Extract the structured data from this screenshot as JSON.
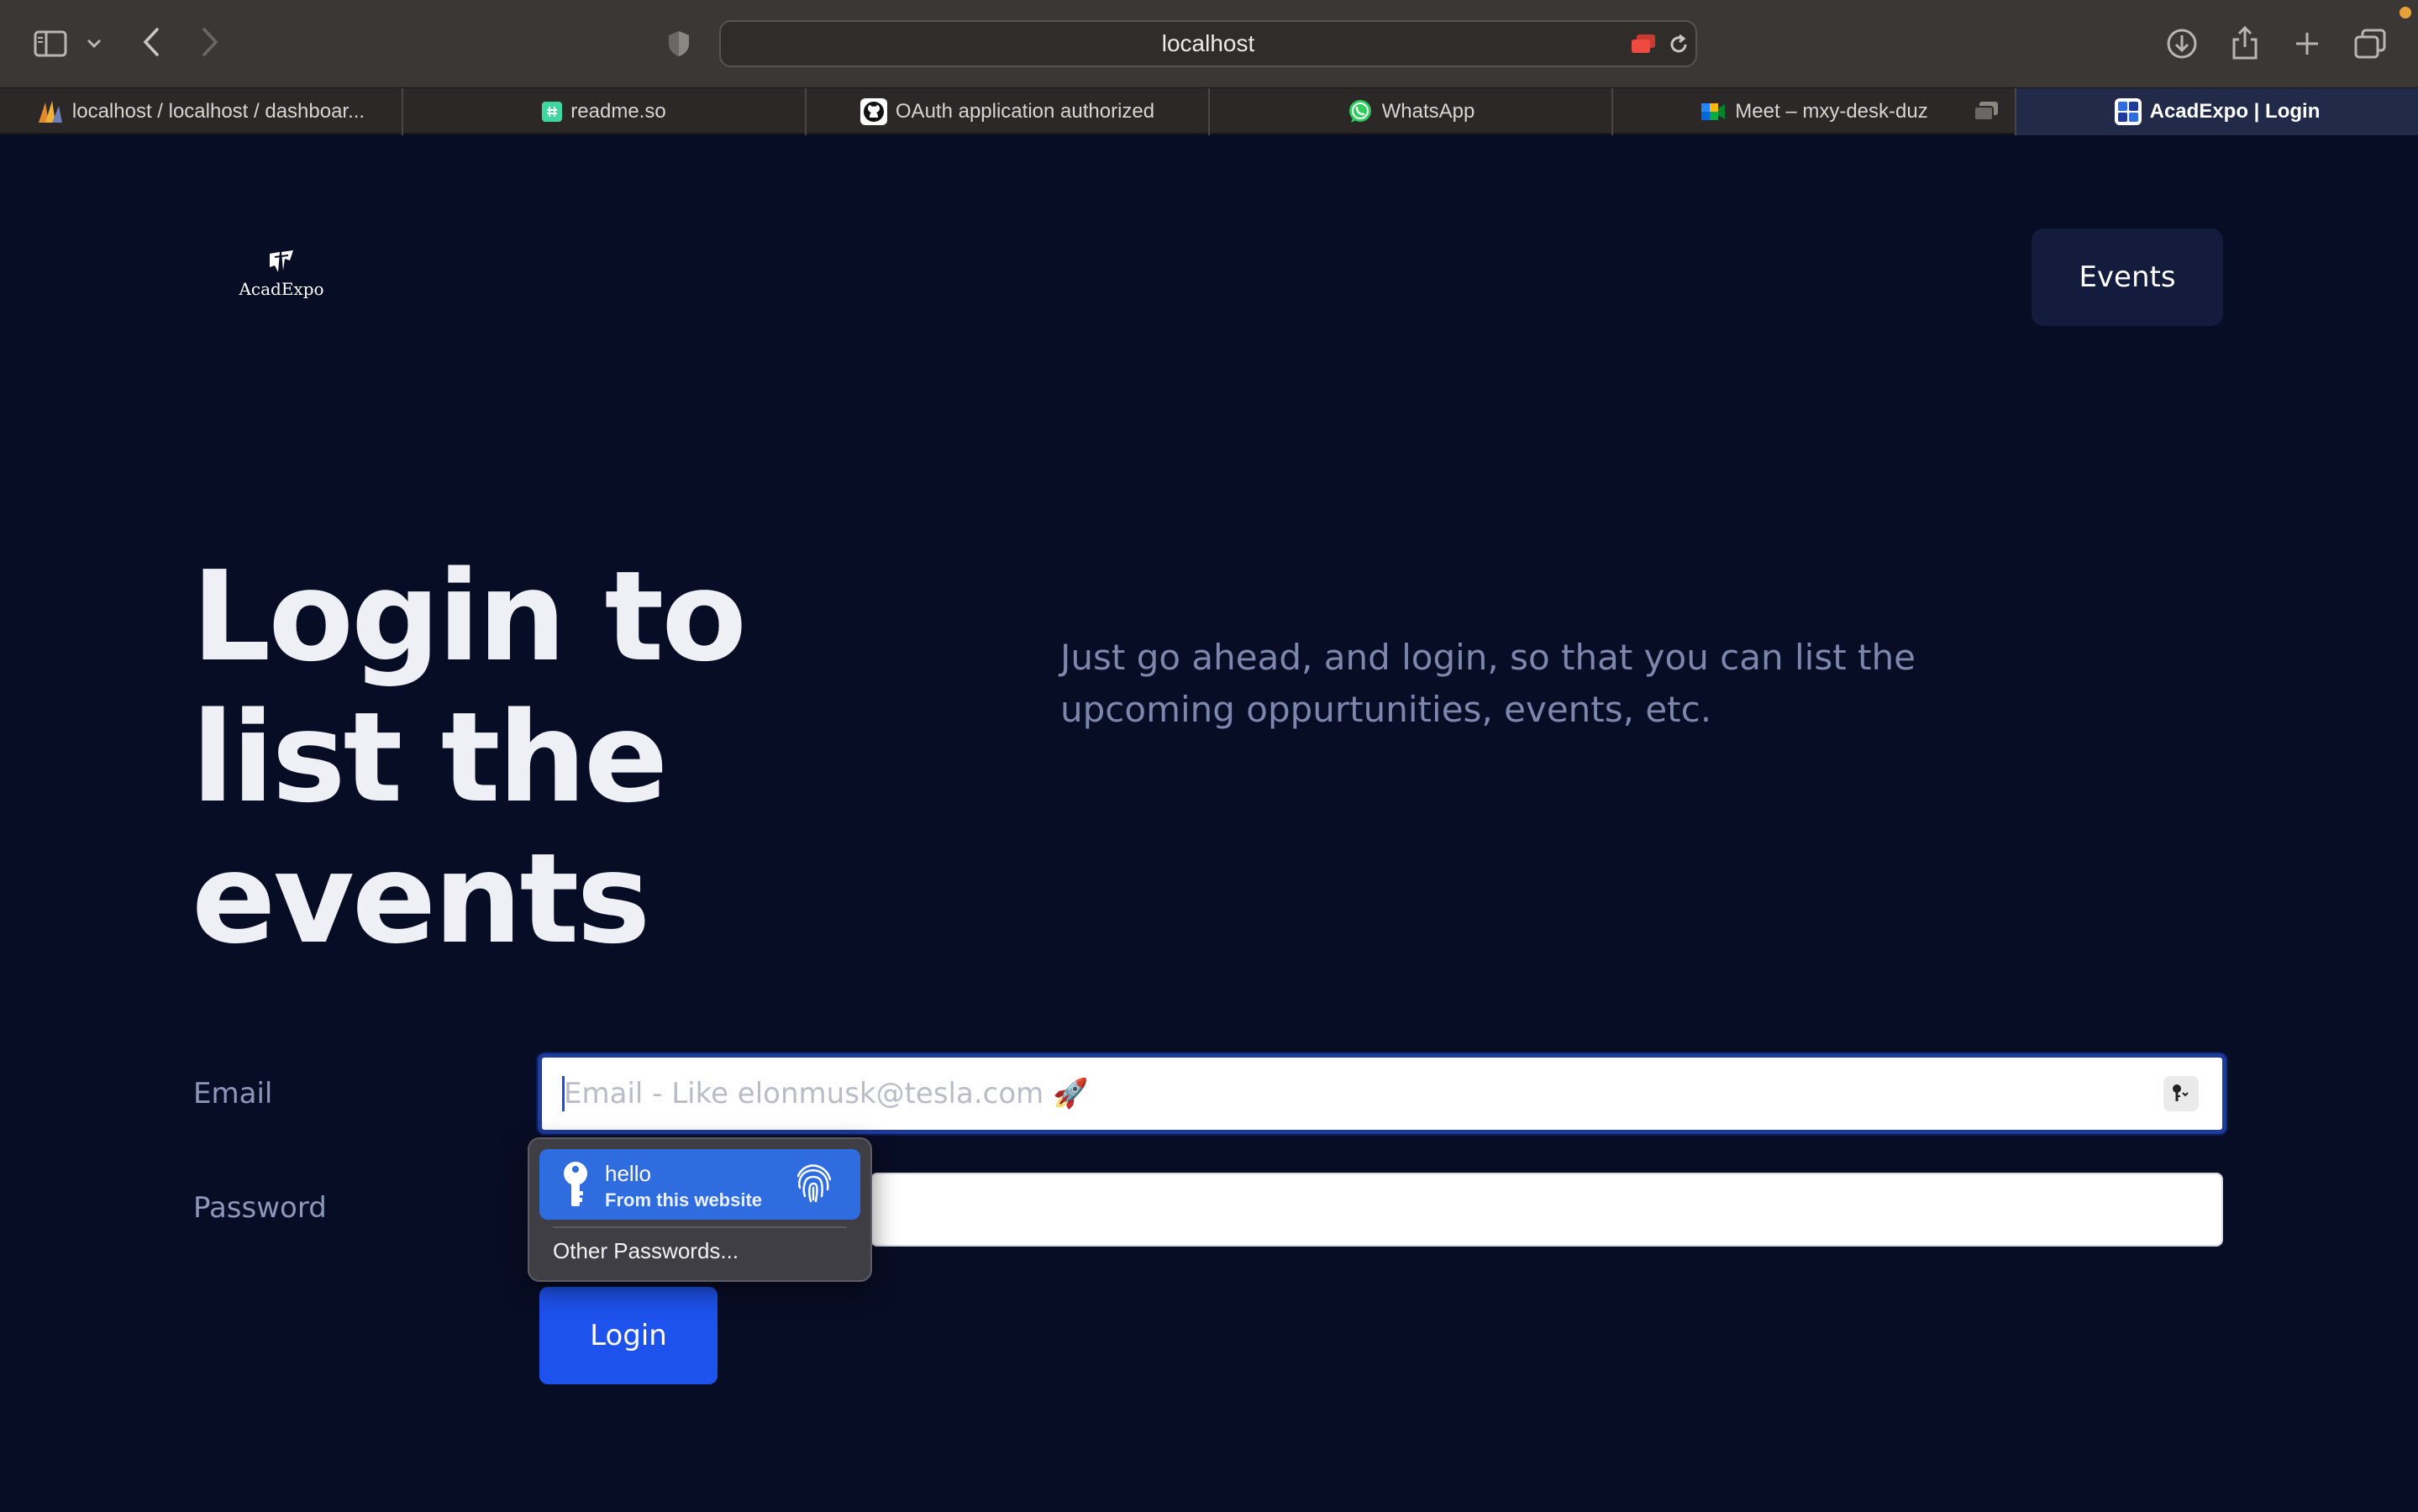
{
  "browser": {
    "url": "localhost",
    "tabs": [
      {
        "label": "localhost / localhost / dashboar...",
        "icon": "phpmyadmin-icon",
        "active": false
      },
      {
        "label": "readme.so",
        "icon": "readme-icon",
        "active": false
      },
      {
        "label": "OAuth application authorized",
        "icon": "github-icon",
        "active": false
      },
      {
        "label": "WhatsApp",
        "icon": "whatsapp-icon",
        "active": false
      },
      {
        "label": "Meet – mxy-desk-duz",
        "icon": "google-meet-icon",
        "active": false
      },
      {
        "label": "AcadExpo | Login",
        "icon": "acadexpo-icon",
        "active": true
      }
    ]
  },
  "header": {
    "logo_text": "AcadExpo",
    "events_button": "Events"
  },
  "hero": {
    "title": "Login to list the events",
    "subtitle": "Just go ahead, and login, so that you can list the upcoming oppurtunities, events, etc."
  },
  "form": {
    "email_label": "Email",
    "email_placeholder": "Email - Like elonmusk@tesla.com 🚀",
    "email_value": "",
    "password_label": "Password",
    "password_value": "",
    "login_button": "Login"
  },
  "autofill": {
    "username": "hello",
    "source": "From this website",
    "other": "Other Passwords..."
  },
  "colors": {
    "page_background": "#080d26",
    "primary_button": "#1d52ec",
    "secondary_button": "#131c3d",
    "autofill_highlight": "#2f6cdf"
  }
}
